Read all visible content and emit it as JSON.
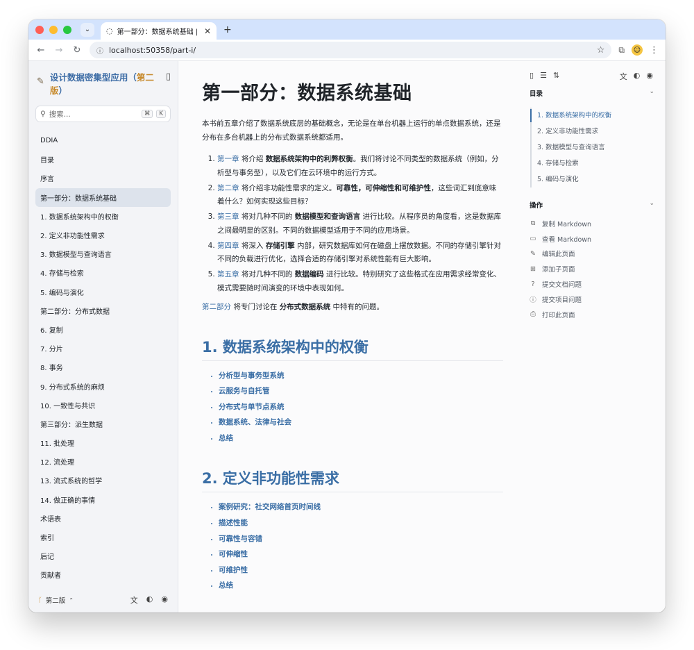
{
  "browser": {
    "tab_title": "第一部分：数据系统基础 | 设计",
    "url": "localhost:50358/part-i/",
    "new_tab": "+",
    "traffic_lights": [
      "#ff5f57",
      "#febc2e",
      "#28c840"
    ]
  },
  "sidebar": {
    "brand_title": "设计数据密集型应用（",
    "brand_edition": "第二版",
    "brand_close": "）",
    "search_placeholder": "搜索...",
    "search_kbd1": "⌘",
    "search_kbd2": "K",
    "items": [
      "DDIA",
      "目录",
      "序言",
      "第一部分：数据系统基础",
      "1. 数据系统架构中的权衡",
      "2. 定义非功能性需求",
      "3. 数据模型与查询语言",
      "4. 存储与检索",
      "5. 编码与演化",
      "第二部分：分布式数据",
      "6. 复制",
      "7. 分片",
      "8. 事务",
      "9. 分布式系统的麻烦",
      "10. 一致性与共识",
      "第三部分：派生数据",
      "11. 批处理",
      "12. 流处理",
      "13. 流式系统的哲学",
      "14. 做正确的事情",
      "术语表",
      "索引",
      "后记",
      "贡献者"
    ],
    "active_index": 3,
    "footer_version": "第二版"
  },
  "main": {
    "title": "第一部分：数据系统基础",
    "intro": "本书前五章介绍了数据系统底层的基础概念，无论是在单台机器上运行的单点数据系统，还是分布在多台机器上的分布式数据系统都适用。",
    "chapters": [
      {
        "link": "第一章",
        "a": " 将介绍 ",
        "b": "数据系统架构中的利弊权衡",
        "c": "。我们将讨论不同类型的数据系统（例如，分析型与事务型），以及它们在云环境中的运行方式。"
      },
      {
        "link": "第二章",
        "a": " 将介绍非功能性需求的定义。",
        "b": "可靠性，可伸缩性和可维护性",
        "c": "，这些词汇到底意味着什么？如何实现这些目标？"
      },
      {
        "link": "第三章",
        "a": " 将对几种不同的 ",
        "b": "数据模型和查询语言",
        "c": " 进行比较。从程序员的角度看，这是数据库之间最明显的区别。不同的数据模型适用于不同的应用场景。"
      },
      {
        "link": "第四章",
        "a": " 将深入 ",
        "b": "存储引擎",
        "c": " 内部，研究数据库如何在磁盘上摆放数据。不同的存储引擎针对不同的负载进行优化，选择合适的存储引擎对系统性能有巨大影响。"
      },
      {
        "link": "第五章",
        "a": " 将对几种不同的 ",
        "b": "数据编码",
        "c": " 进行比较。特别研究了这些格式在应用需求经常变化、模式需要随时间演变的环境中表现如何。"
      }
    ],
    "part2_link": "第二部分",
    "part2_a": " 将专门讨论在 ",
    "part2_b": "分布式数据系统",
    "part2_c": " 中特有的问题。",
    "sections": [
      {
        "heading": "1. 数据系统架构中的权衡",
        "items": [
          "分析型与事务型系统",
          "云服务与自托管",
          "分布式与单节点系统",
          "数据系统、法律与社会",
          "总结"
        ]
      },
      {
        "heading": "2. 定义非功能性需求",
        "items": [
          "案例研究：社交网络首页时间线",
          "描述性能",
          "可靠性与容错",
          "可伸缩性",
          "可维护性",
          "总结"
        ]
      }
    ]
  },
  "toc": {
    "heading": "目录",
    "items": [
      "1. 数据系统架构中的权衡",
      "2. 定义非功能性需求",
      "3. 数据模型与查询语言",
      "4. 存储与检索",
      "5. 编码与演化"
    ],
    "ops_heading": "操作",
    "ops": [
      "复制 Markdown",
      "查看 Markdown",
      "编辑此页面",
      "添加子页面",
      "提交文档问题",
      "提交项目问题",
      "打印此页面"
    ]
  }
}
